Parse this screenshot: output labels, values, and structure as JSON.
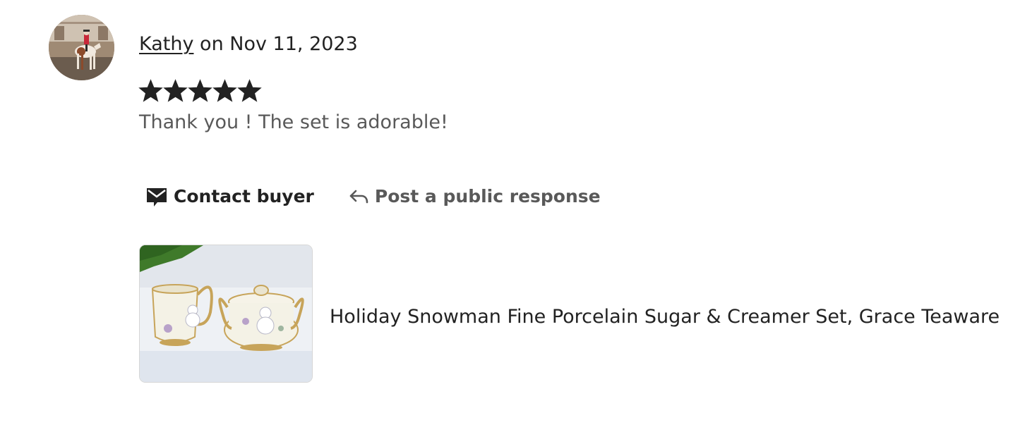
{
  "review": {
    "reviewer_name": "Kathy",
    "date_text": " on Nov 11, 2023",
    "rating": 5,
    "rating_max": 5,
    "text": "Thank you ! The set is adorable!"
  },
  "actions": {
    "contact_buyer_label": "Contact buyer",
    "public_response_label": "Post a public response"
  },
  "listing": {
    "title": "Holiday Snowman Fine Porcelain Sugar & Creamer Set, Grace Teaware"
  },
  "icons": {
    "avatar": "avatar-photo",
    "contact": "envelope-icon",
    "reply": "reply-arrow-icon",
    "star": "star-icon"
  },
  "colors": {
    "text_primary": "#222222",
    "text_secondary": "#595959",
    "star": "#222222"
  }
}
